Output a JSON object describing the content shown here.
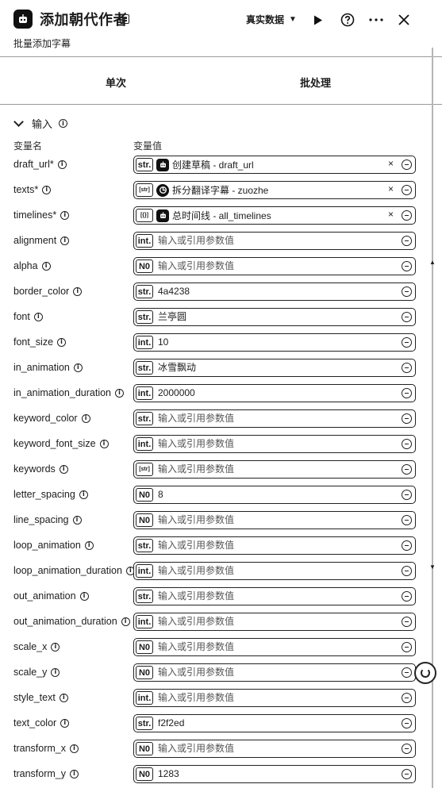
{
  "header": {
    "title": "添加朝代作者",
    "subtitle": "批量添加字幕",
    "mode_label": "真实数据",
    "app_icon": "coze-robot-icon",
    "actions": [
      "play-icon",
      "help-icon",
      "more-icon",
      "close-icon"
    ]
  },
  "tabs": [
    {
      "label": "单次"
    },
    {
      "label": "批处理"
    }
  ],
  "input_section": {
    "title": "输入",
    "col_name": "变量名",
    "col_value": "变量值"
  },
  "params": [
    {
      "name": "draft_url*",
      "type": "str.",
      "ref": {
        "icon": "coze-robot-icon",
        "text": "创建草稿 - draft_url"
      }
    },
    {
      "name": "texts*",
      "type": "[str]",
      "ref": {
        "icon": "translate-node-icon",
        "text": "拆分翻译字幕 - zuozhe"
      }
    },
    {
      "name": "timelines*",
      "type": "[{}]",
      "ref": {
        "icon": "coze-robot-icon",
        "text": "总时间线 - all_timelines"
      }
    },
    {
      "name": "alignment",
      "type": "int.",
      "value": "输入或引用参数值",
      "placeholder": true
    },
    {
      "name": "alpha",
      "type": "N0",
      "value": "输入或引用参数值",
      "placeholder": true
    },
    {
      "name": "border_color",
      "type": "str.",
      "value": "4a4238"
    },
    {
      "name": "font",
      "type": "str.",
      "value": "兰亭圆"
    },
    {
      "name": "font_size",
      "type": "int.",
      "value": "10"
    },
    {
      "name": "in_animation",
      "type": "str.",
      "value": "冰雪飘动"
    },
    {
      "name": "in_animation_duration",
      "type": "int.",
      "value": "2000000"
    },
    {
      "name": "keyword_color",
      "type": "str.",
      "value": "输入或引用参数值",
      "placeholder": true
    },
    {
      "name": "keyword_font_size",
      "type": "int.",
      "value": "输入或引用参数值",
      "placeholder": true
    },
    {
      "name": "keywords",
      "type": "[str]",
      "value": "输入或引用参数值",
      "placeholder": true
    },
    {
      "name": "letter_spacing",
      "type": "N0",
      "value": "8"
    },
    {
      "name": "line_spacing",
      "type": "N0",
      "value": "输入或引用参数值",
      "placeholder": true
    },
    {
      "name": "loop_animation",
      "type": "str.",
      "value": "输入或引用参数值",
      "placeholder": true
    },
    {
      "name": "loop_animation_duration",
      "type": "int.",
      "value": "输入或引用参数值",
      "placeholder": true
    },
    {
      "name": "out_animation",
      "type": "str.",
      "value": "输入或引用参数值",
      "placeholder": true
    },
    {
      "name": "out_animation_duration",
      "type": "int.",
      "value": "输入或引用参数值",
      "placeholder": true
    },
    {
      "name": "scale_x",
      "type": "N0",
      "value": "输入或引用参数值",
      "placeholder": true
    },
    {
      "name": "scale_y",
      "type": "N0",
      "value": "输入或引用参数值",
      "placeholder": true
    },
    {
      "name": "style_text",
      "type": "int.",
      "value": "输入或引用参数值",
      "placeholder": true
    },
    {
      "name": "text_color",
      "type": "str.",
      "value": "f2f2ed"
    },
    {
      "name": "transform_x",
      "type": "N0",
      "value": "输入或引用参数值",
      "placeholder": true
    },
    {
      "name": "transform_y",
      "type": "N0",
      "value": "1283"
    }
  ]
}
